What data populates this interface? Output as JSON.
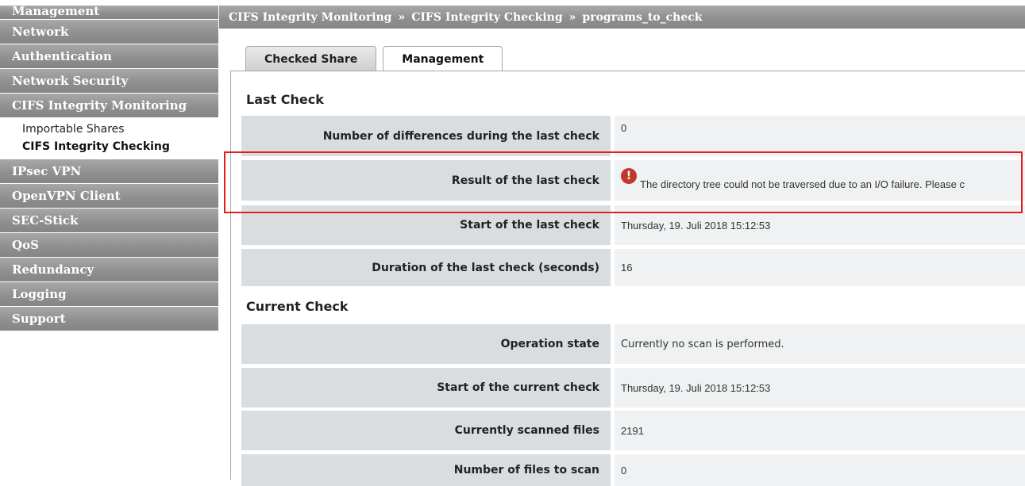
{
  "sidebar": {
    "items": [
      {
        "label": "Management"
      },
      {
        "label": "Network"
      },
      {
        "label": "Authentication"
      },
      {
        "label": "Network Security"
      },
      {
        "label": "CIFS Integrity Monitoring"
      },
      {
        "label": "IPsec VPN"
      },
      {
        "label": "OpenVPN Client"
      },
      {
        "label": "SEC-Stick"
      },
      {
        "label": "QoS"
      },
      {
        "label": "Redundancy"
      },
      {
        "label": "Logging"
      },
      {
        "label": "Support"
      }
    ],
    "subitems": [
      {
        "label": "Importable Shares"
      },
      {
        "label": "CIFS Integrity Checking"
      }
    ]
  },
  "breadcrumb": {
    "items": [
      "CIFS Integrity Monitoring",
      "CIFS Integrity Checking",
      "programs_to_check"
    ],
    "separator": "»"
  },
  "tabs": [
    {
      "label": "Checked Share",
      "active": false
    },
    {
      "label": "Management",
      "active": true
    }
  ],
  "sections": {
    "last_check": {
      "title": "Last Check",
      "rows": [
        {
          "label": "Number of differences during the last check",
          "value": "0"
        },
        {
          "label": "Result of the last check",
          "value": "The directory tree could not be traversed due to an I/O failure. Please c",
          "icon": "error-icon"
        },
        {
          "label": "Start of the last check",
          "value": "Thursday, 19. Juli 2018 15:12:53"
        },
        {
          "label": "Duration of the last check (seconds)",
          "value": "16"
        }
      ]
    },
    "current_check": {
      "title": "Current Check",
      "rows": [
        {
          "label": "Operation state",
          "value": "Currently no scan is performed."
        },
        {
          "label": "Start of the current check",
          "value": "Thursday, 19. Juli 2018 15:12:53"
        },
        {
          "label": "Currently scanned files",
          "value": "2191"
        },
        {
          "label": "Number of files to scan",
          "value": "0"
        }
      ]
    }
  },
  "colors": {
    "sidebar_bg": "#8e8e8e",
    "label_cell": "#d9dde0",
    "value_cell": "#eff1f2",
    "highlight": "#e41e1e",
    "error_icon": "#c0392b"
  }
}
